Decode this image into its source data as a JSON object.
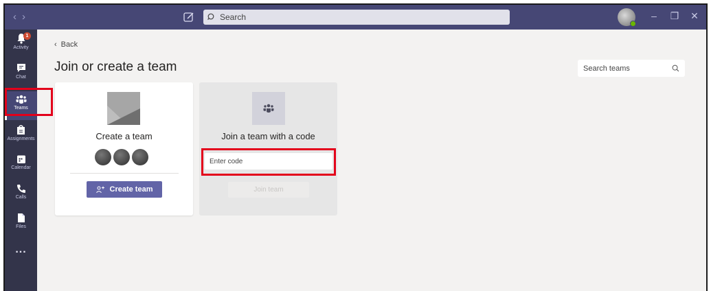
{
  "titlebar": {
    "search_placeholder": "Search"
  },
  "rail": {
    "items": [
      {
        "label": "Activity",
        "icon": "bell-icon",
        "badge": "1"
      },
      {
        "label": "Chat",
        "icon": "chat-icon"
      },
      {
        "label": "Teams",
        "icon": "teams-icon",
        "active": true
      },
      {
        "label": "Assignments",
        "icon": "assignments-icon"
      },
      {
        "label": "Calendar",
        "icon": "calendar-icon"
      },
      {
        "label": "Calls",
        "icon": "phone-icon"
      },
      {
        "label": "Files",
        "icon": "file-icon"
      }
    ],
    "more": "..."
  },
  "main": {
    "back_label": "Back",
    "title": "Join or create a team",
    "search_teams_placeholder": "Search teams",
    "create_card": {
      "title": "Create a team",
      "button_label": "Create team"
    },
    "join_card": {
      "title": "Join a team with a code",
      "code_placeholder": "Enter code",
      "button_label": "Join team"
    }
  },
  "colors": {
    "titlebar": "#464775",
    "rail": "#33344a",
    "accent": "#6264a7",
    "highlight": "#e3001b",
    "badge": "#cc4a31"
  }
}
